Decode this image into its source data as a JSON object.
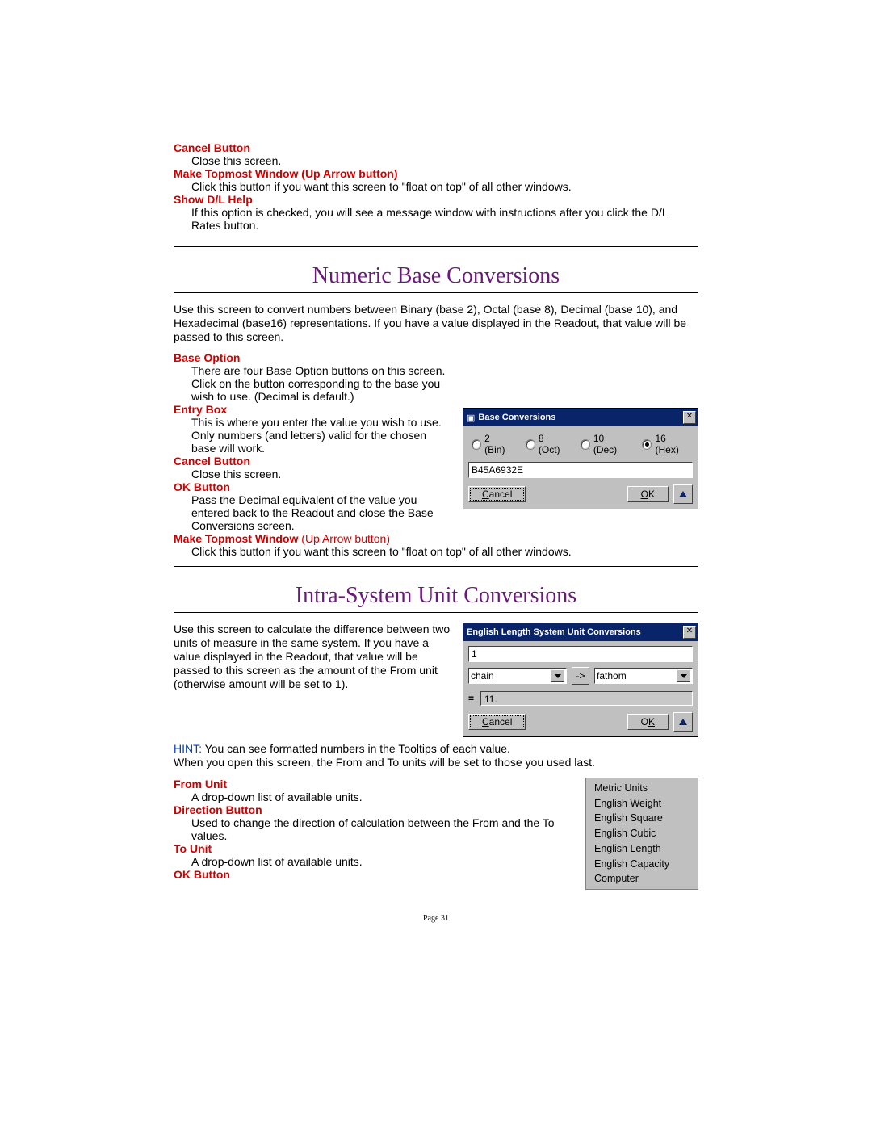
{
  "top_section": {
    "items": [
      {
        "term": "Cancel Button",
        "desc": "Close this screen."
      },
      {
        "term": "Make Topmost Window (Up Arrow button)",
        "desc": "Click this button if you want this screen to \"float on top\" of all other windows."
      },
      {
        "term": "Show D/L Help",
        "desc": "If this option is checked, you will see a message window with instructions after you click the D/L Rates button."
      }
    ]
  },
  "section_numeric": {
    "title": "Numeric Base Conversions",
    "intro": "Use this screen to convert numbers between Binary (base 2), Octal (base 8), Decimal (base 10), and Hexadecimal (base16) representations.  If you have a value displayed in the Readout, that value will be passed to this screen.",
    "items": [
      {
        "term": "Base Option",
        "desc": "There are four Base Option buttons on this screen.  Click on the button corresponding to the base you wish to use.  (Decimal is default.)"
      },
      {
        "term": "Entry Box",
        "desc": "This is where you enter the value you wish to use.  Only numbers (and letters) valid for the chosen base will work."
      },
      {
        "term": "Cancel Button",
        "desc": "Close this screen."
      },
      {
        "term": "OK Button",
        "desc": "Pass the Decimal equivalent of the value you entered back to the Readout and close the Base Conversions screen."
      },
      {
        "term": "Make Topmost Window",
        "term_suffix": " (Up Arrow button)",
        "desc": "Click this button if you want this screen to \"float on top\" of all other windows."
      }
    ]
  },
  "base_conv_window": {
    "title": "Base Conversions",
    "radios": [
      {
        "label": "2 (Bin)",
        "checked": false
      },
      {
        "label": "8 (Oct)",
        "checked": false
      },
      {
        "label": "10 (Dec)",
        "checked": false
      },
      {
        "label": "16 (Hex)",
        "checked": true
      }
    ],
    "entry_value": "B45A6932E",
    "cancel": "Cancel",
    "ok": "OK"
  },
  "section_intra": {
    "title": "Intra-System Unit Conversions",
    "intro": "Use this screen to calculate the difference between two units of measure in the same system.  If you have a value displayed in the Readout, that value will be passed to this screen as the amount of the From unit (otherwise amount will be set to 1).",
    "hint_label": "HINT:",
    "hint_body": "  You can see formatted numbers in the Tooltips of each value.",
    "hint_line2": "When you open this screen, the From and To units will be set to those you used last.",
    "items": [
      {
        "term": "From Unit",
        "desc": "A drop-down list of available units."
      },
      {
        "term": "Direction Button",
        "desc": "Used to change the direction of calculation between the From and the To values."
      },
      {
        "term": "To Unit",
        "desc": "A drop-down list of available units."
      },
      {
        "term": "OK Button",
        "desc": ""
      }
    ]
  },
  "unit_window": {
    "title": "English Length System Unit Conversions",
    "input_value": "1",
    "from_unit": "chain",
    "to_unit": "fathom",
    "arrow": "->",
    "eq": "=",
    "result": "11.",
    "cancel": "Cancel",
    "ok": "OK"
  },
  "category_list": [
    "Metric Units",
    "English Weight",
    "English Square",
    "English Cubic",
    "English Length",
    "English Capacity",
    "Computer"
  ],
  "page_number": "Page 31"
}
